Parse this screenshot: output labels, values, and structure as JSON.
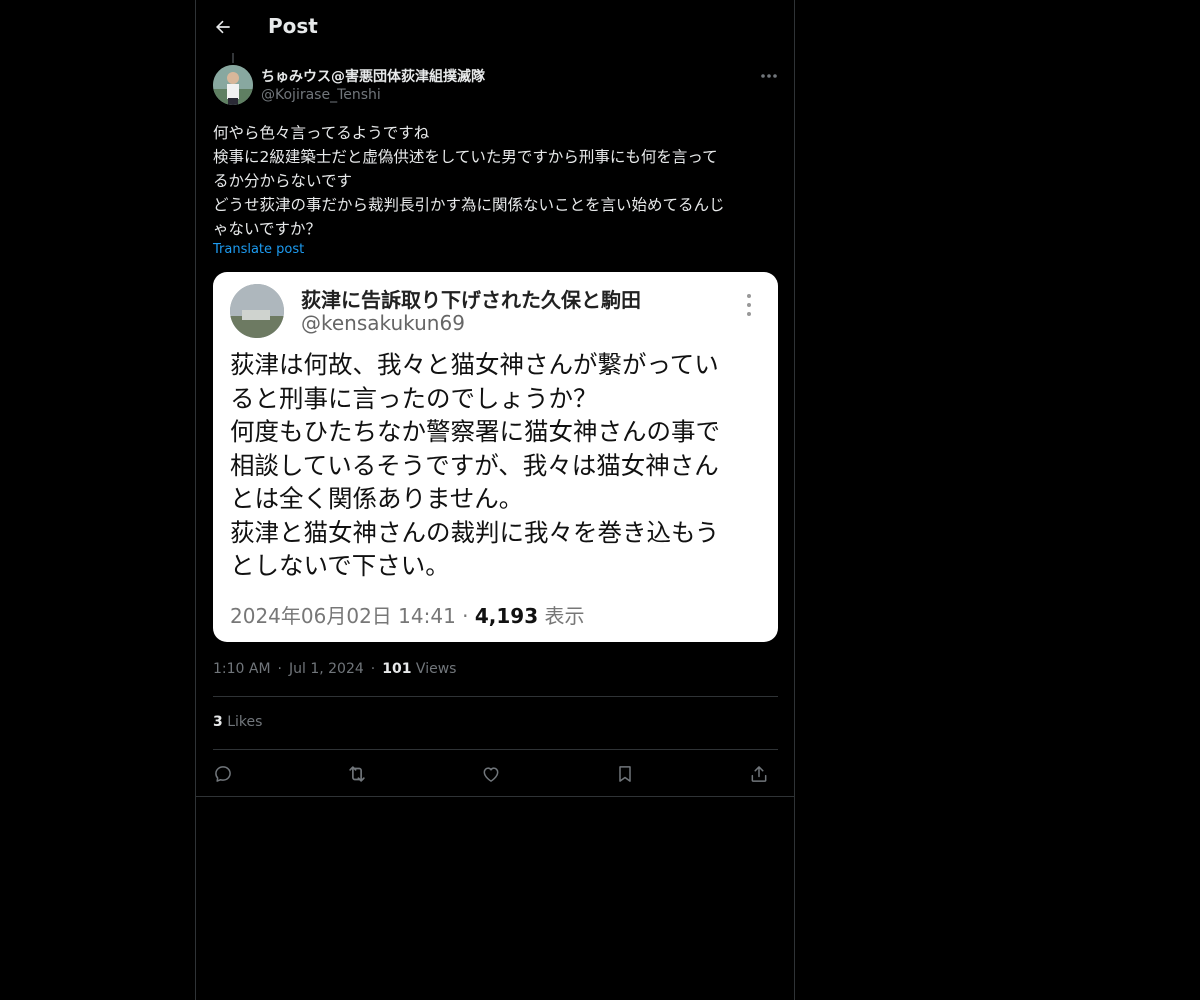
{
  "header": {
    "title": "Post"
  },
  "author": {
    "name": "ちゅみウス@害悪団体荻津組撲滅隊",
    "handle": "@Kojirase_Tenshi"
  },
  "post": {
    "lines": [
      "何やら色々言ってるようですね",
      "検事に2級建築士だと虚偽供述をしていた男ですから刑事にも何を言って",
      "るか分からないです",
      "どうせ荻津の事だから裁判長引かす為に関係ないことを言い始めてるんじ",
      "ゃないですか？"
    ],
    "translate_label": "Translate post"
  },
  "quoted": {
    "name": "荻津に告訴取り下げされた久保と駒田",
    "handle": "@kensakukun69",
    "lines": [
      "荻津は何故、我々と猫女神さんが繋がってい",
      "ると刑事に言ったのでしょうか？",
      "何度もひたちなか警察署に猫女神さんの事で",
      "相談しているそうですが、我々は猫女神さん",
      "とは全く関係ありません。",
      "荻津と猫女神さんの裁判に我々を巻き込もう",
      "としないで下さい。"
    ],
    "datetime": "2024年06月02日 14:41 · ",
    "views_count": "4,193",
    "views_label": " 表示"
  },
  "meta": {
    "time": "1:10 AM",
    "sep": "·",
    "date": "Jul 1, 2024",
    "views_count": "101",
    "views_label": "Views"
  },
  "likes": {
    "count": "3",
    "label": "Likes"
  },
  "actions": {
    "reply": "reply-icon",
    "repost": "repost-icon",
    "like": "heart-icon",
    "bookmark": "bookmark-icon",
    "share": "share-icon"
  },
  "colors": {
    "background": "#000000",
    "text": "#e7e9ea",
    "muted": "#71767b",
    "link": "#1d9bf0",
    "border": "#2f3336"
  }
}
